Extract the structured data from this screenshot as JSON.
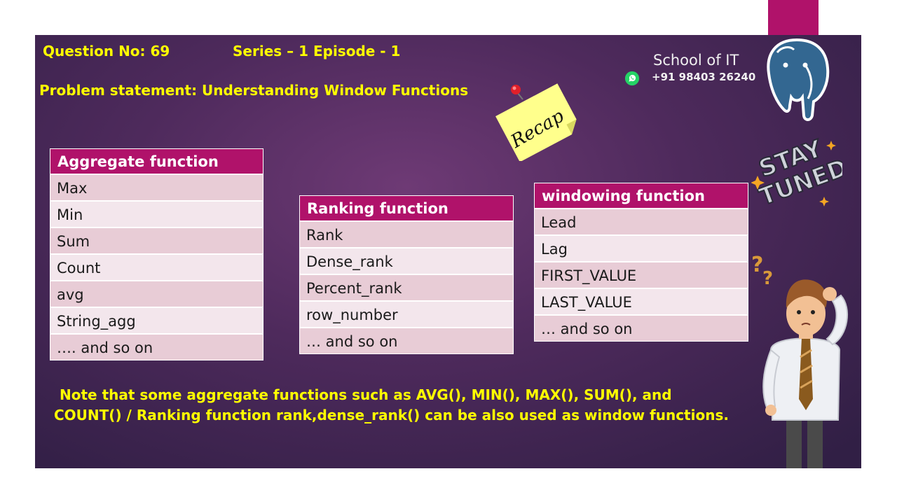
{
  "header": {
    "question": "Question No: 69",
    "series": "Series – 1 Episode - 1",
    "problem": "Problem statement: Understanding Window Functions"
  },
  "brand": {
    "name": "School of IT",
    "phone": "+91 98403 26240"
  },
  "sticky_note": "Recap",
  "badge_text": [
    "STAY",
    "TUNED"
  ],
  "aggregate": {
    "title": "Aggregate function",
    "rows": [
      "Max",
      "Min",
      "Sum",
      "Count",
      "avg",
      "String_agg",
      "…. and so on"
    ]
  },
  "ranking": {
    "title": "Ranking function",
    "rows": [
      "Rank",
      "Dense_rank",
      "Percent_rank",
      "row_number",
      "… and so on"
    ]
  },
  "windowing": {
    "title": "windowing function",
    "rows": [
      "Lead",
      "Lag",
      "FIRST_VALUE",
      "LAST_VALUE",
      "… and so on"
    ]
  },
  "note": {
    "line1": "Note that some aggregate functions such as AVG(), MIN(), MAX(), SUM(), and",
    "line2": "COUNT() / Ranking function rank,dense_rank() can be also used as window functions."
  },
  "colors": {
    "accent": "#b0126a",
    "highlight_text": "#ffff00",
    "row_odd": "#e8ccd6",
    "row_even": "#f3e6ec"
  },
  "icons": [
    "whatsapp-icon",
    "postgresql-elephant-icon",
    "pushpin-icon",
    "question-marks-icon"
  ]
}
